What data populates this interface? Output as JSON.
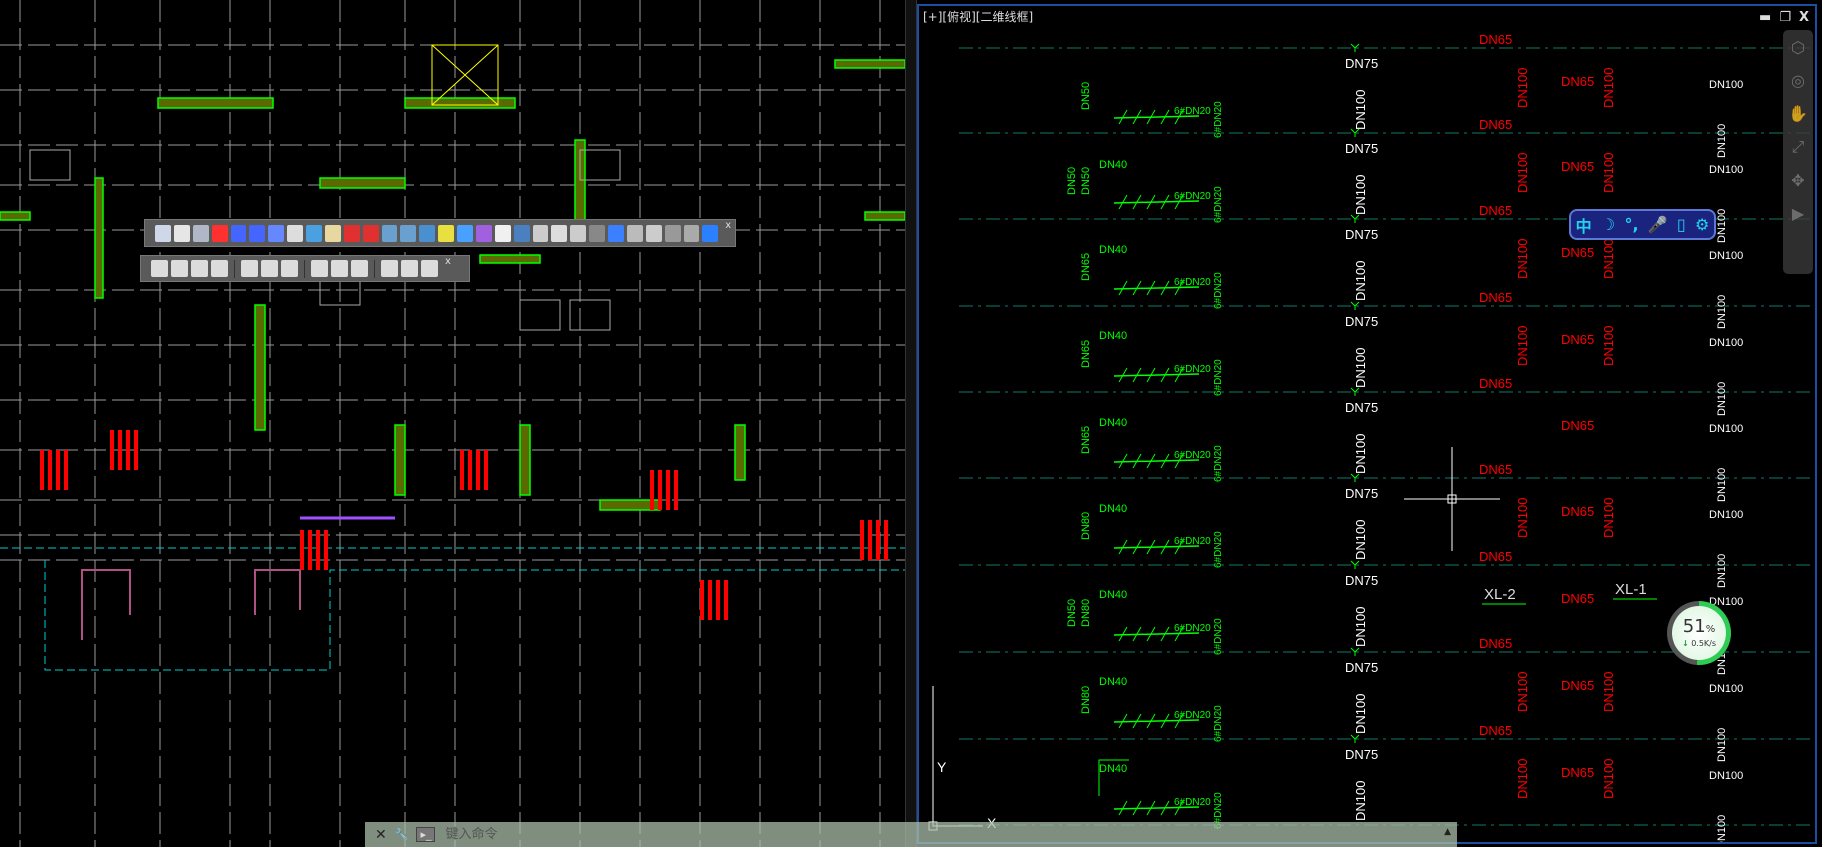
{
  "viewport": {
    "title": "[+][俯视][二维线框]",
    "window_controls": [
      "minimize",
      "restore",
      "close"
    ],
    "window_control_glyphs": [
      "▬",
      "❐",
      "X"
    ],
    "rows": [
      {
        "left": [
          "DN50"
        ],
        "branch": "6#DN20",
        "riser": "DN75",
        "riser_v": "DN100",
        "red_top": "DN65",
        "red_v1": "DN100",
        "red_mid": "DN65",
        "red_v2": "DN100",
        "white_h": "DN100",
        "white_v": "DN100",
        "green_bottom": "DN40"
      },
      {
        "left": [
          "DN50",
          "DN50"
        ],
        "branch": "6#DN20",
        "riser": "DN75",
        "riser_v": "DN100",
        "red_top": "DN65",
        "red_v1": "DN100",
        "red_mid": "DN65",
        "red_v2": "DN100",
        "white_h": "DN100",
        "white_v": "DN100",
        "green_bottom": "DN40"
      },
      {
        "left": [
          "DN65"
        ],
        "branch": "6#DN20",
        "riser": "DN75",
        "riser_v": "DN100",
        "red_top": "DN65",
        "red_v1": "DN100",
        "red_mid": "DN65",
        "red_v2": "DN100",
        "white_h": "DN100",
        "white_v": "DN100",
        "green_bottom": "DN40"
      },
      {
        "left": [
          "DN65"
        ],
        "branch": "6#DN20",
        "riser": "DN75",
        "riser_v": "DN100",
        "red_top": "DN65",
        "red_v1": "DN100",
        "red_mid": "DN65",
        "red_v2": "DN100",
        "white_h": "DN100",
        "white_v": "DN100",
        "green_bottom": "DN40"
      },
      {
        "left": [
          "DN65"
        ],
        "branch": "6#DN20",
        "riser": "DN75",
        "riser_v": "DN100",
        "red_top": "DN65",
        "red_v1": "",
        "red_mid": "DN65",
        "red_v2": "",
        "white_h": "DN100",
        "white_v": "DN100",
        "green_bottom": "DN40"
      },
      {
        "left": [
          "DN80"
        ],
        "branch": "6#DN20",
        "riser": "DN75",
        "riser_v": "DN100",
        "red_top": "DN65",
        "red_v1": "DN100",
        "red_mid": "DN65",
        "red_v2": "DN100",
        "white_h": "DN100",
        "white_v": "DN100",
        "green_bottom": "DN40"
      },
      {
        "left": [
          "DN50",
          "DN80"
        ],
        "branch": "6#DN20",
        "riser": "DN75",
        "riser_v": "DN100",
        "red_top": "DN65",
        "red_v1": "",
        "red_mid": "DN65",
        "red_v2": "",
        "white_h": "DN100",
        "white_v": "DN100",
        "green_bottom": "DN40"
      },
      {
        "left": [
          "DN80"
        ],
        "branch": "6#DN20",
        "riser": "DN75",
        "riser_v": "DN100",
        "red_top": "DN65",
        "red_v1": "DN100",
        "red_mid": "DN65",
        "red_v2": "DN100",
        "white_h": "DN100",
        "white_v": "DN100",
        "green_bottom": "DN40"
      },
      {
        "left": [],
        "branch": "6#DN20",
        "riser": "DN75",
        "riser_v": "DN100",
        "red_top": "DN65",
        "red_v1": "DN100",
        "red_mid": "DN65",
        "red_v2": "DN100",
        "white_h": "DN100",
        "white_v": "DN100",
        "green_bottom": "DN40"
      }
    ],
    "riser_tags": [
      "XL-2",
      "XL-1"
    ],
    "ucs": {
      "y_label": "Y",
      "x_label": "X"
    }
  },
  "toolbars": {
    "top_icon_count": 30,
    "bottom_groups": [
      4,
      3,
      3,
      3
    ],
    "close_glyph": "x"
  },
  "ime_bar": {
    "items": [
      "中",
      "☽",
      "°,",
      "🎤",
      "▯",
      "⚙"
    ],
    "names": [
      "chinese-mode",
      "half-width",
      "punctuation",
      "voice",
      "keyboard",
      "settings"
    ]
  },
  "network_widget": {
    "percent": 51,
    "percent_text": "51",
    "unit": "%",
    "speed": "0.5K/s",
    "arrow": "↓"
  },
  "command_line": {
    "close": "✕",
    "wrench": "🔧",
    "prompt": "▸_",
    "placeholder": "键入命令"
  },
  "colors": {
    "background": "#000000",
    "green_text": "#00ff00",
    "red_text": "#ff0000",
    "white_text": "#ffffff",
    "viewport_border": "#1c4fa0",
    "axis_line": "#0f5f4f"
  }
}
